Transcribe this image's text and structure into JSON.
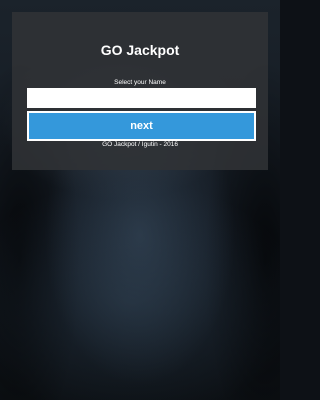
{
  "app": {
    "title": "GO Jackpot",
    "prompt": "Select your Name",
    "name_input": {
      "value": "",
      "placeholder": ""
    },
    "next_label": "next",
    "footer": "GO Jackpot / Igutin - 2016"
  },
  "colors": {
    "button": "#3498db",
    "panel": "#303235",
    "text": "#ffffff"
  }
}
